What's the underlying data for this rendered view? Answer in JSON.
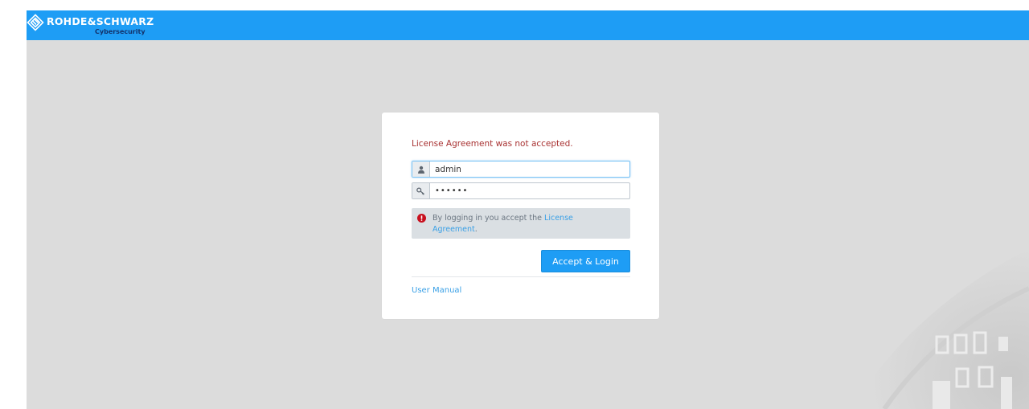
{
  "header": {
    "brand_name": "ROHDE&SCHWARZ",
    "brand_sub": "Cybersecurity",
    "logo_icon": "rohde-schwarz-diamond-logo",
    "bar_color": "#1e9df5"
  },
  "login": {
    "error_message": "License Agreement was not accepted.",
    "username": {
      "icon": "user-icon",
      "value": "admin"
    },
    "password": {
      "icon": "key-icon",
      "value": "••••••"
    },
    "notice": {
      "icon": "exclamation-circle-icon",
      "text_before": "By logging in you accept the ",
      "link_text": "License Agreement",
      "text_after": "."
    },
    "submit_label": "Accept & Login",
    "manual_link": "User Manual"
  },
  "colors": {
    "accent": "#1e9df5",
    "error": "#a83232",
    "link": "#3aa0e6"
  }
}
